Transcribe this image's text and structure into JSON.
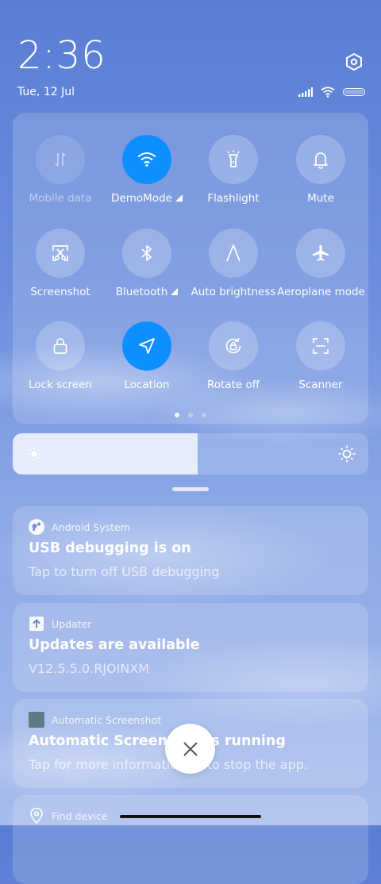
{
  "header": {
    "time": "2:36",
    "date": "Tue, 12 Jul",
    "settings_icon": "settings-hexagon-icon"
  },
  "status_bar": {
    "icons": [
      "signal-icon",
      "wifi-icon",
      "battery-icon"
    ]
  },
  "control_panel": {
    "tiles": [
      {
        "label": "Mobile data",
        "icon": "mobile-data-icon",
        "state": "disabled"
      },
      {
        "label": "DemoMode",
        "icon": "wifi-icon",
        "state": "active",
        "has_more": true
      },
      {
        "label": "Flashlight",
        "icon": "flashlight-icon",
        "state": "inactive"
      },
      {
        "label": "Mute",
        "icon": "bell-icon",
        "state": "inactive"
      },
      {
        "label": "Screenshot",
        "icon": "screenshot-icon",
        "state": "inactive"
      },
      {
        "label": "Bluetooth",
        "icon": "bluetooth-icon",
        "state": "inactive",
        "has_more": true
      },
      {
        "label": "Auto brightness",
        "icon": "auto-brightness-icon",
        "state": "inactive"
      },
      {
        "label": "Aeroplane mode",
        "icon": "airplane-icon",
        "state": "inactive"
      },
      {
        "label": "Lock screen",
        "icon": "lock-icon",
        "state": "inactive"
      },
      {
        "label": "Location",
        "icon": "location-arrow-icon",
        "state": "active"
      },
      {
        "label": "Rotate off",
        "icon": "rotate-lock-icon",
        "state": "inactive"
      },
      {
        "label": "Scanner",
        "icon": "scanner-icon",
        "state": "inactive"
      }
    ],
    "page_count": 3,
    "current_page": 1
  },
  "brightness": {
    "level": 0.52
  },
  "notifications": [
    {
      "app": "Android System",
      "app_icon": "android-system-icon",
      "title": "USB debugging is on",
      "body": "Tap to turn off USB debugging"
    },
    {
      "app": "Updater",
      "app_icon": "updater-arrow-icon",
      "title": "Updates are available",
      "body": "V12.5.5.0.RJOINXM"
    },
    {
      "app": "Automatic Screenshot",
      "app_icon": "automatic-screenshot-icon",
      "title": "Automatic Screenshot is running",
      "body": "Tap for more information or to stop the app."
    },
    {
      "app": "Find device",
      "app_icon": "location-pin-icon",
      "title": "",
      "body": ""
    }
  ],
  "colors": {
    "accent_active": "#0d8fff",
    "background_top": "#5a7ed4",
    "background_bottom": "#a7bcec"
  }
}
